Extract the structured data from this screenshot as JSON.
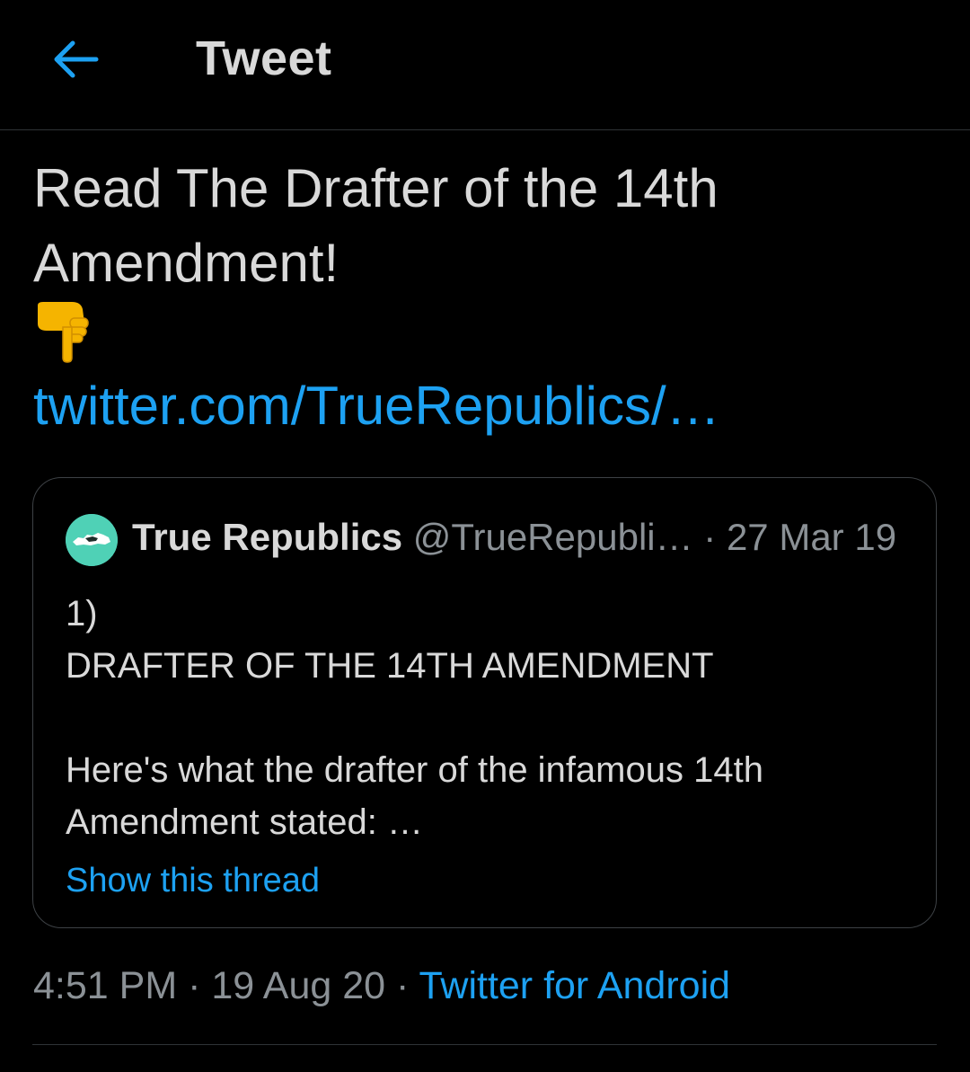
{
  "header": {
    "title": "Tweet",
    "back_icon": "arrow-left-icon"
  },
  "tweet": {
    "text_line1": "Read The Drafter of the 14th",
    "text_line2": "Amendment!",
    "emoji_icon": "backhand-index-pointing-down-icon",
    "link": "twitter.com/TrueRepublics/…"
  },
  "quote": {
    "avatar_icon": "true-republics-avatar-icon",
    "name": "True Republics",
    "handle": "@TrueRepubli…",
    "separator": " · ",
    "date": "27 Mar 19",
    "body_line1": "1)",
    "body_line2": "DRAFTER OF THE 14TH AMENDMENT",
    "body_line3": "",
    "body_line4": "Here's what the drafter of the infamous 14th",
    "body_line5": "Amendment stated: …",
    "show_thread": "Show this thread"
  },
  "meta": {
    "time": "4:51 PM",
    "sep1": " · ",
    "date": "19 Aug 20",
    "sep2": " · ",
    "source": "Twitter for Android"
  },
  "colors": {
    "background": "#000000",
    "text": "#d9d9d9",
    "accent": "#1da1f2",
    "secondary": "#8b9196",
    "border": "#3d4145",
    "avatar": "#4fd1b6"
  }
}
